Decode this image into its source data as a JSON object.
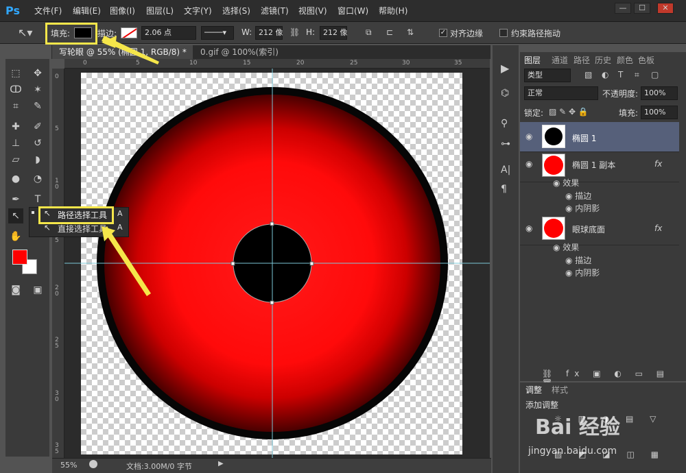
{
  "app": {
    "logo": "Ps"
  },
  "menu": [
    "文件(F)",
    "编辑(E)",
    "图像(I)",
    "图层(L)",
    "文字(Y)",
    "选择(S)",
    "滤镜(T)",
    "视图(V)",
    "窗口(W)",
    "帮助(H)"
  ],
  "window_buttons": [
    "—",
    "☐",
    "✕"
  ],
  "options": {
    "fill_label": "填充:",
    "stroke_label": "描边:",
    "stroke_width": "2.06 点",
    "w_label": "W:",
    "w_value": "212 像",
    "h_label": "H:",
    "h_value": "212 像",
    "align_edges": "对齐边缘",
    "constrain_path": "约束路径拖动"
  },
  "tabs": [
    "写轮眼 @ 55% (椭圆 1, RGB/8) *",
    "0.gif @ 100%(索引)"
  ],
  "ruler_top": [
    "0",
    "5",
    "10",
    "15",
    "20",
    "25",
    "30",
    "35"
  ],
  "ruler_left": [
    "0",
    "5",
    "1\n0",
    "1\n5",
    "2\n0",
    "2\n5",
    "3\n0",
    "3\n5"
  ],
  "flyout": {
    "items": [
      {
        "label": "路径选择工具",
        "key": "A"
      },
      {
        "label": "直接选择工具",
        "key": "A"
      }
    ]
  },
  "status": {
    "zoom": "55%",
    "doc": "文档:3.00M/0 字节"
  },
  "layers_panel": {
    "tabs": [
      "图层",
      "通道",
      "路径",
      "历史",
      "颜色",
      "色板"
    ],
    "filter": "类型",
    "blend": "正常",
    "opacity_label": "不透明度:",
    "opacity": "100%",
    "lock_label": "锁定:",
    "fill_label": "填充:",
    "fill": "100%",
    "layers": [
      {
        "name": "椭圆 1",
        "fx": ""
      },
      {
        "name": "椭圆 1 副本",
        "fx": "fx",
        "effects_label": "效果",
        "effects": [
          "描边",
          "内阴影"
        ]
      },
      {
        "name": "眼球底面",
        "fx": "fx",
        "effects_label": "效果",
        "effects": [
          "描边",
          "内阴影"
        ]
      }
    ]
  },
  "adjust_panel": {
    "tabs": [
      "调整",
      "样式"
    ],
    "title": "添加调整"
  },
  "watermark": {
    "line1": "Bai 经验",
    "line2": "jingyan.baidu.com"
  },
  "colors": {
    "accent": "#f5e64a",
    "fg": "#ff0000",
    "bg": "#ffffff"
  }
}
